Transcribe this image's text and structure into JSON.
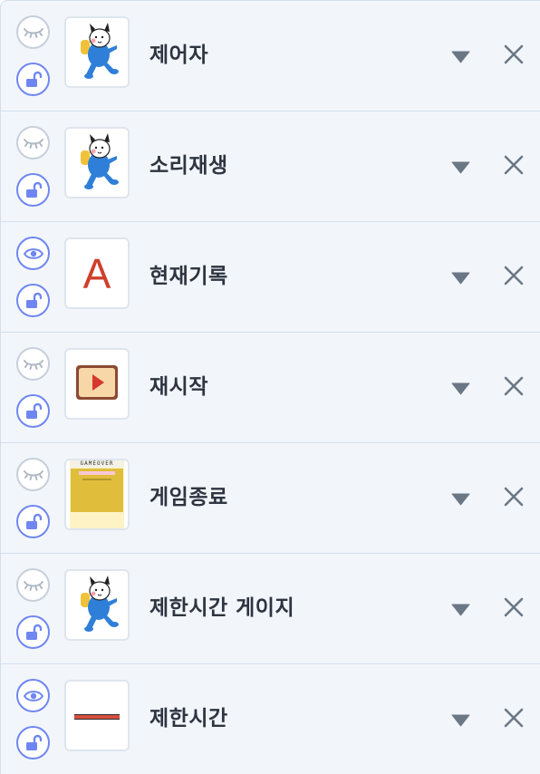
{
  "sprites": [
    {
      "name": "제어자",
      "thumbnail": "character",
      "visible": false,
      "locked": false
    },
    {
      "name": "소리재생",
      "thumbnail": "character",
      "visible": false,
      "locked": false
    },
    {
      "name": "현재기록",
      "thumbnail": "text",
      "thumbnail_text": "A",
      "visible": true,
      "locked": false
    },
    {
      "name": "재시작",
      "thumbnail": "play-button",
      "visible": false,
      "locked": false
    },
    {
      "name": "게임종료",
      "thumbnail": "gameover-panel",
      "thumbnail_text": "GAMEOVER",
      "visible": false,
      "locked": false
    },
    {
      "name": "제한시간 게이지",
      "thumbnail": "character",
      "visible": false,
      "locked": false
    },
    {
      "name": "제한시간",
      "thumbnail": "red-line",
      "visible": true,
      "locked": false
    }
  ],
  "icons": {
    "visibility_on": "eye-icon",
    "visibility_off": "eye-closed-icon",
    "lock": "unlock-icon",
    "menu": "caret-down-icon",
    "delete": "close-icon"
  },
  "colors": {
    "row_bg": "#f2f6fb",
    "border": "#d3dfec",
    "accent": "#6f86f2",
    "muted_icon": "#aeb8c4",
    "text": "#2e3440",
    "caret": "#6b7785"
  }
}
